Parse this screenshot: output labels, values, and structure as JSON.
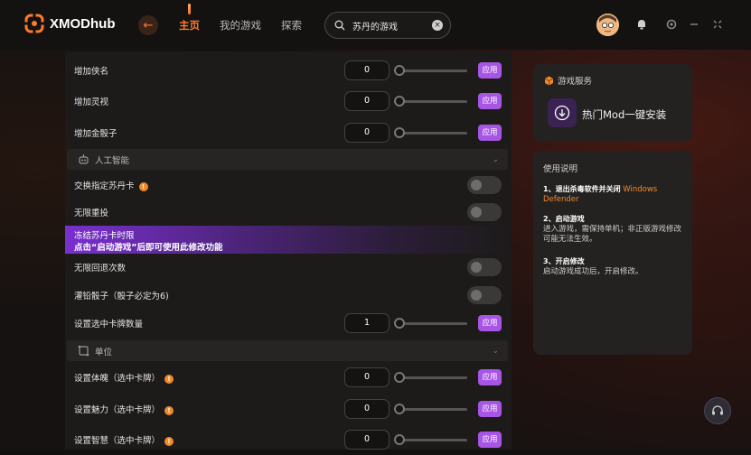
{
  "header": {
    "logo_text": "XMODhub",
    "nav": [
      {
        "label": "主页",
        "active": true
      },
      {
        "label": "我的游戏",
        "active": false
      },
      {
        "label": "探索",
        "active": false
      }
    ],
    "search": {
      "value": "苏丹的游戏"
    }
  },
  "main": {
    "rows_top": [
      {
        "label": "增加侠名",
        "value": "0",
        "apply": "应用"
      },
      {
        "label": "增加灵视",
        "value": "0",
        "apply": "应用"
      },
      {
        "label": "增加金骰子",
        "value": "0",
        "apply": "应用"
      }
    ],
    "section_ai": {
      "label": "人工智能"
    },
    "toggle_rows": [
      {
        "label": "交换指定苏丹卡",
        "warn": "!"
      },
      {
        "label": "无限重投"
      }
    ],
    "tooltip": {
      "title": "冻结苏丹卡时限",
      "body": "点击“启动游戏”后即可使用此修改功能"
    },
    "toggle_rows_2": [
      {
        "label": "无限回退次数"
      },
      {
        "label": "灌铅骰子（骰子必定为6)"
      }
    ],
    "card_count": {
      "label": "设置选中卡牌数量",
      "value": "1",
      "apply": "应用"
    },
    "section_unit": {
      "label": "单位"
    },
    "unit_rows": [
      {
        "label": "设置体魄（选中卡牌）",
        "value": "0",
        "apply": "应用",
        "warn": "!"
      },
      {
        "label": "设置魅力（选中卡牌）",
        "value": "0",
        "apply": "应用",
        "warn": "!"
      },
      {
        "label": "设置智慧（选中卡牌）",
        "value": "0",
        "apply": "应用",
        "warn": "!"
      }
    ]
  },
  "service": {
    "title": "游戏服务",
    "install_label": "热门Mod一键安装"
  },
  "guide": {
    "title": "使用说明",
    "step1_title": "1、退出杀毒软件并关闭",
    "step1_orange": "Windows Defender",
    "step2_title": "2、启动游戏",
    "step2_body": "进入游戏，需保持单机；非正版游戏修改可能无法生效。",
    "step3_title": "3、开启修改",
    "step3_body": "启动游戏成功后，开启修改。"
  },
  "colors": {
    "accent": "#ff7a2a",
    "apply": "#a855e6",
    "warn": "#f08a28"
  }
}
